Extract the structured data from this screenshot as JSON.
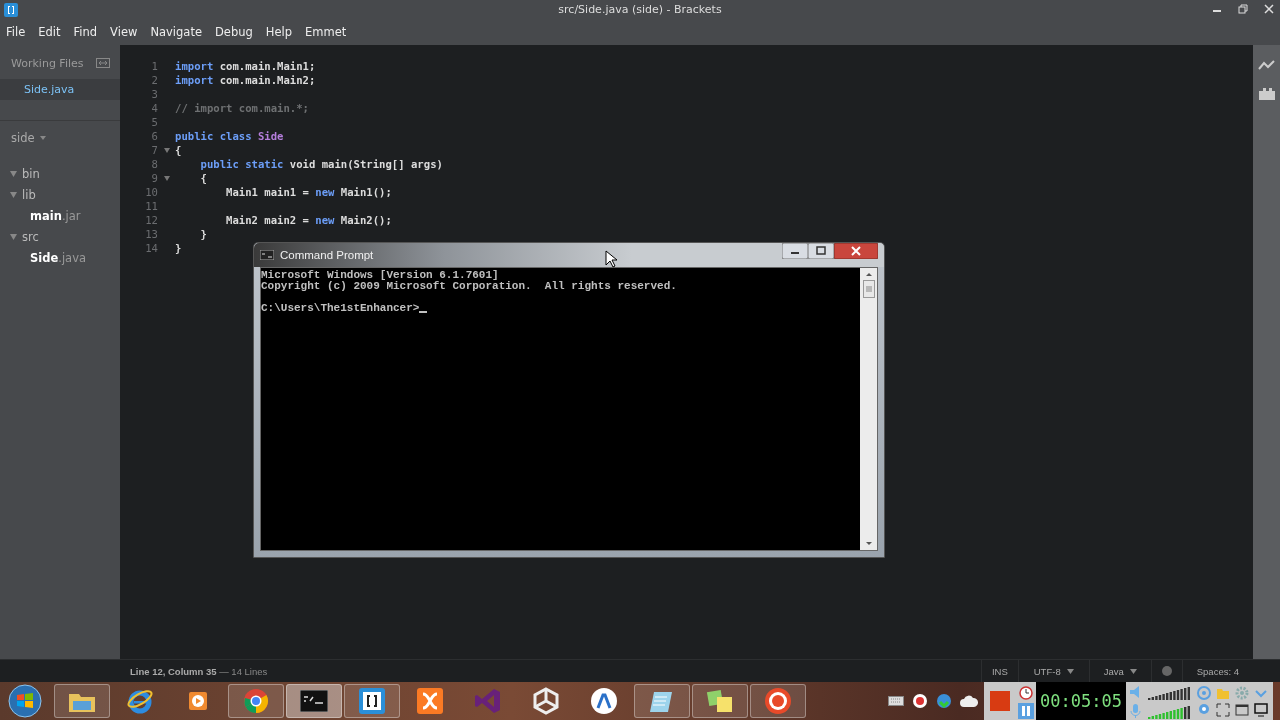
{
  "window": {
    "title": "src/Side.java (side) - Brackets"
  },
  "menu": [
    "File",
    "Edit",
    "Find",
    "View",
    "Navigate",
    "Debug",
    "Help",
    "Emmet"
  ],
  "sidebar": {
    "working_files_title": "Working Files",
    "working_files": [
      {
        "name": "Side.java",
        "selected": true
      }
    ],
    "project": "side",
    "tree": [
      {
        "name": "bin",
        "kind": "folder",
        "expanded": true
      },
      {
        "name": "lib",
        "kind": "folder",
        "expanded": true,
        "children": [
          {
            "name": "**main**.jar"
          }
        ]
      },
      {
        "name": "src",
        "kind": "folder",
        "expanded": true,
        "children": [
          {
            "name": "**Side**.java"
          }
        ]
      }
    ]
  },
  "editor": {
    "lines": [
      {
        "number": "1",
        "foldable": false,
        "tokens": [
          {
            "kind": "keyword",
            "text": "import"
          },
          {
            "kind": "plain",
            "text": " com.main.Main1;"
          }
        ]
      },
      {
        "number": "2",
        "foldable": false,
        "tokens": [
          {
            "kind": "keyword",
            "text": "import"
          },
          {
            "kind": "plain",
            "text": " com.main.Main2;"
          }
        ]
      },
      {
        "number": "3",
        "foldable": false
      },
      {
        "number": "4",
        "foldable": false,
        "tokens": [
          {
            "kind": "comment",
            "text": "// import com.main.*;"
          }
        ]
      },
      {
        "number": "5",
        "foldable": false
      },
      {
        "number": "6",
        "foldable": false,
        "tokens": [
          {
            "kind": "keyword",
            "text": "public class "
          },
          {
            "kind": "type",
            "text": "Side"
          }
        ]
      },
      {
        "number": "7",
        "foldable": true,
        "tokens": [
          {
            "kind": "plain",
            "text": "{"
          }
        ]
      },
      {
        "number": "8",
        "foldable": false,
        "tokens": [
          {
            "kind": "keyword",
            "text": "    public static"
          },
          {
            "kind": "plain",
            "text": " void main(String[] args)"
          }
        ]
      },
      {
        "number": "9",
        "foldable": true,
        "tokens": [
          {
            "kind": "plain",
            "text": "    {"
          }
        ]
      },
      {
        "number": "10",
        "foldable": false,
        "tokens": [
          {
            "kind": "plain",
            "text": "        Main1 main1 = "
          },
          {
            "kind": "keyword",
            "text": "new"
          },
          {
            "kind": "plain",
            "text": " Main1();"
          }
        ]
      },
      {
        "number": "11",
        "foldable": false
      },
      {
        "number": "12",
        "foldable": false,
        "tokens": [
          {
            "kind": "plain",
            "text": "        Main2 main2 = "
          },
          {
            "kind": "keyword",
            "text": "new"
          },
          {
            "kind": "plain",
            "text": " Main2();"
          }
        ]
      },
      {
        "number": "13",
        "foldable": false,
        "tokens": [
          {
            "kind": "plain",
            "text": "    }"
          }
        ]
      },
      {
        "number": "14",
        "foldable": false,
        "tokens": [
          {
            "kind": "plain",
            "text": "}"
          }
        ]
      }
    ]
  },
  "status_bar": {
    "position": "**Line 12, Column 35** — 14 Lines",
    "mode": "INS",
    "encoding": "UTF-8",
    "language": "Java",
    "indent": "Spaces: 4"
  },
  "command_prompt": {
    "title": "Command Prompt",
    "lines": [
      {
        "kind": "output",
        "text": "Microsoft Windows [Version 6.1.7601]"
      },
      {
        "kind": "output",
        "text": "Copyright (c) 2009 Microsoft Corporation.  All rights reserved."
      },
      {
        "kind": "prompt",
        "text": "C:\\Users\\The1stEnhancer>"
      }
    ]
  },
  "taskbar": {
    "apps": [
      {
        "kind": "explorer",
        "running": true,
        "selected": false
      },
      {
        "kind": "ie",
        "running": false,
        "selected": false
      },
      {
        "kind": "media",
        "running": false,
        "selected": false
      },
      {
        "kind": "chrome",
        "running": true,
        "selected": false
      },
      {
        "kind": "cmd",
        "running": true,
        "selected": true
      },
      {
        "kind": "brackets",
        "running": true,
        "selected": false
      },
      {
        "kind": "xampp",
        "running": false,
        "selected": false
      },
      {
        "kind": "vs",
        "running": false,
        "selected": false
      },
      {
        "kind": "unity",
        "running": false,
        "selected": false
      },
      {
        "kind": "studio",
        "running": false,
        "selected": false
      },
      {
        "kind": "notepad",
        "running": true,
        "selected": false
      },
      {
        "kind": "sticky",
        "running": true,
        "selected": false
      },
      {
        "kind": "recorder",
        "running": true,
        "selected": false
      }
    ],
    "recorder_time": "00:05:05"
  }
}
